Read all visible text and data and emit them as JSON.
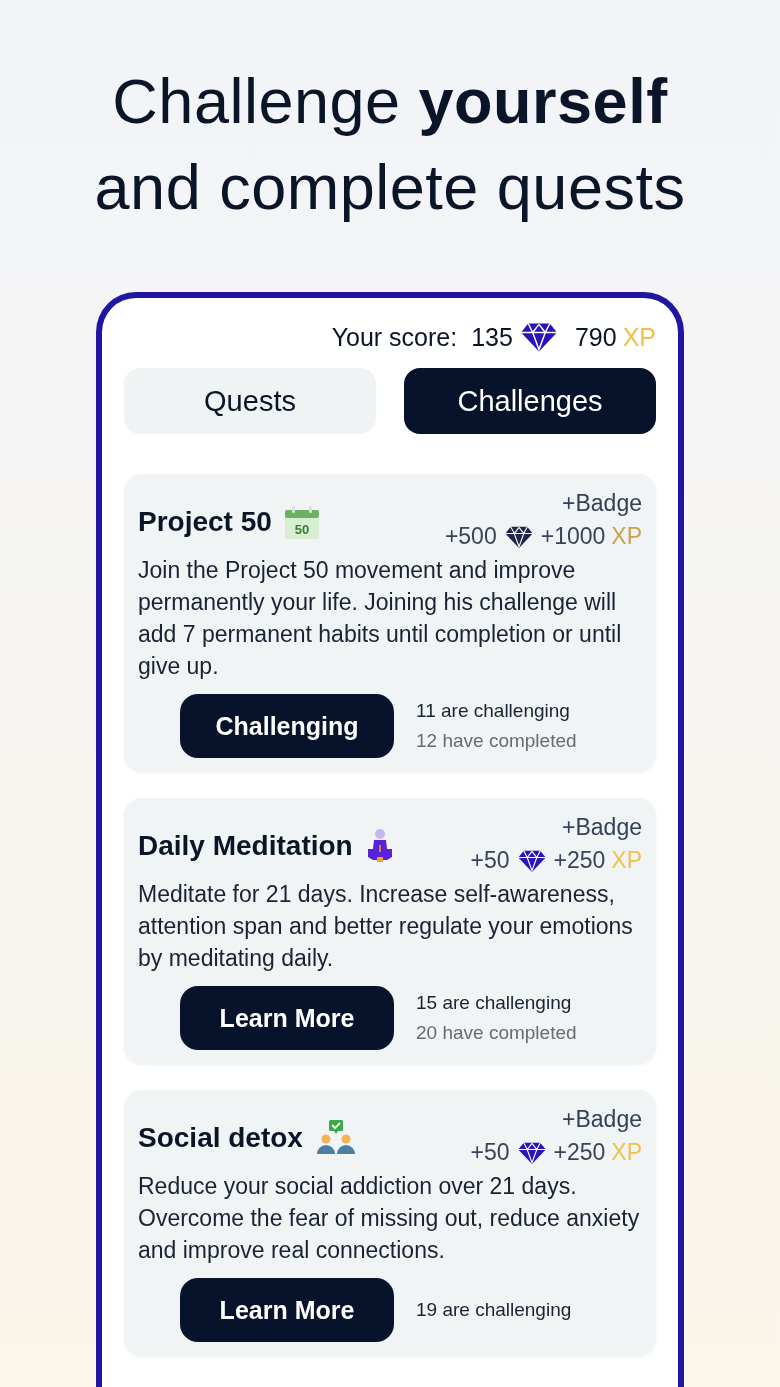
{
  "headline": "Challenge **yourself**\nand complete quests",
  "score": {
    "label": "Your score:",
    "gems": "135",
    "xp": "790",
    "xp_unit": "XP"
  },
  "tabs": [
    {
      "label": "Quests",
      "selected": false
    },
    {
      "label": "Challenges",
      "selected": true
    }
  ],
  "challenges": [
    {
      "title": "Project 50",
      "kind": "calendar",
      "icon_text": "50",
      "joined": true,
      "reward": "+Badge",
      "gems": "+500",
      "xp": "+1000",
      "xp_unit": "XP",
      "description": "Join the Project 50 movement and improve permanently your life. Joining his challenge will add 7 permanent habits until completion or until give up.",
      "button": "Challenging",
      "challenging": "11 are challenging",
      "completed": "12 have completed"
    },
    {
      "title": "Daily Meditation",
      "kind": "meditation",
      "joined": false,
      "reward": "+Badge",
      "gems": "+50",
      "xp": "+250",
      "xp_unit": "XP",
      "description": "Meditate for 21 days. Increase self-awareness, attention span and better regulate your emotions by meditating daily.",
      "button": "Learn More",
      "challenging": "15 are challenging",
      "completed": "20 have completed"
    },
    {
      "title": "Social detox",
      "kind": "people",
      "joined": false,
      "reward": "+Badge",
      "gems": "+50",
      "xp": "+250",
      "xp_unit": "XP",
      "description": "Reduce your social addiction over 21 days. Overcome the fear of missing out, reduce anxiety and improve real connections.",
      "button": "Learn More",
      "challenging": "19 are challenging"
    }
  ]
}
